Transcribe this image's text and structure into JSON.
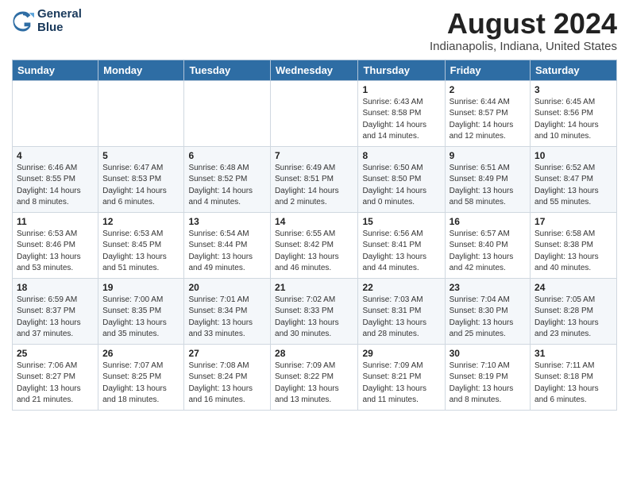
{
  "logo": {
    "line1": "General",
    "line2": "Blue"
  },
  "title": "August 2024",
  "location": "Indianapolis, Indiana, United States",
  "headers": [
    "Sunday",
    "Monday",
    "Tuesday",
    "Wednesday",
    "Thursday",
    "Friday",
    "Saturday"
  ],
  "weeks": [
    [
      {
        "day": "",
        "info": ""
      },
      {
        "day": "",
        "info": ""
      },
      {
        "day": "",
        "info": ""
      },
      {
        "day": "",
        "info": ""
      },
      {
        "day": "1",
        "info": "Sunrise: 6:43 AM\nSunset: 8:58 PM\nDaylight: 14 hours\nand 14 minutes."
      },
      {
        "day": "2",
        "info": "Sunrise: 6:44 AM\nSunset: 8:57 PM\nDaylight: 14 hours\nand 12 minutes."
      },
      {
        "day": "3",
        "info": "Sunrise: 6:45 AM\nSunset: 8:56 PM\nDaylight: 14 hours\nand 10 minutes."
      }
    ],
    [
      {
        "day": "4",
        "info": "Sunrise: 6:46 AM\nSunset: 8:55 PM\nDaylight: 14 hours\nand 8 minutes."
      },
      {
        "day": "5",
        "info": "Sunrise: 6:47 AM\nSunset: 8:53 PM\nDaylight: 14 hours\nand 6 minutes."
      },
      {
        "day": "6",
        "info": "Sunrise: 6:48 AM\nSunset: 8:52 PM\nDaylight: 14 hours\nand 4 minutes."
      },
      {
        "day": "7",
        "info": "Sunrise: 6:49 AM\nSunset: 8:51 PM\nDaylight: 14 hours\nand 2 minutes."
      },
      {
        "day": "8",
        "info": "Sunrise: 6:50 AM\nSunset: 8:50 PM\nDaylight: 14 hours\nand 0 minutes."
      },
      {
        "day": "9",
        "info": "Sunrise: 6:51 AM\nSunset: 8:49 PM\nDaylight: 13 hours\nand 58 minutes."
      },
      {
        "day": "10",
        "info": "Sunrise: 6:52 AM\nSunset: 8:47 PM\nDaylight: 13 hours\nand 55 minutes."
      }
    ],
    [
      {
        "day": "11",
        "info": "Sunrise: 6:53 AM\nSunset: 8:46 PM\nDaylight: 13 hours\nand 53 minutes."
      },
      {
        "day": "12",
        "info": "Sunrise: 6:53 AM\nSunset: 8:45 PM\nDaylight: 13 hours\nand 51 minutes."
      },
      {
        "day": "13",
        "info": "Sunrise: 6:54 AM\nSunset: 8:44 PM\nDaylight: 13 hours\nand 49 minutes."
      },
      {
        "day": "14",
        "info": "Sunrise: 6:55 AM\nSunset: 8:42 PM\nDaylight: 13 hours\nand 46 minutes."
      },
      {
        "day": "15",
        "info": "Sunrise: 6:56 AM\nSunset: 8:41 PM\nDaylight: 13 hours\nand 44 minutes."
      },
      {
        "day": "16",
        "info": "Sunrise: 6:57 AM\nSunset: 8:40 PM\nDaylight: 13 hours\nand 42 minutes."
      },
      {
        "day": "17",
        "info": "Sunrise: 6:58 AM\nSunset: 8:38 PM\nDaylight: 13 hours\nand 40 minutes."
      }
    ],
    [
      {
        "day": "18",
        "info": "Sunrise: 6:59 AM\nSunset: 8:37 PM\nDaylight: 13 hours\nand 37 minutes."
      },
      {
        "day": "19",
        "info": "Sunrise: 7:00 AM\nSunset: 8:35 PM\nDaylight: 13 hours\nand 35 minutes."
      },
      {
        "day": "20",
        "info": "Sunrise: 7:01 AM\nSunset: 8:34 PM\nDaylight: 13 hours\nand 33 minutes."
      },
      {
        "day": "21",
        "info": "Sunrise: 7:02 AM\nSunset: 8:33 PM\nDaylight: 13 hours\nand 30 minutes."
      },
      {
        "day": "22",
        "info": "Sunrise: 7:03 AM\nSunset: 8:31 PM\nDaylight: 13 hours\nand 28 minutes."
      },
      {
        "day": "23",
        "info": "Sunrise: 7:04 AM\nSunset: 8:30 PM\nDaylight: 13 hours\nand 25 minutes."
      },
      {
        "day": "24",
        "info": "Sunrise: 7:05 AM\nSunset: 8:28 PM\nDaylight: 13 hours\nand 23 minutes."
      }
    ],
    [
      {
        "day": "25",
        "info": "Sunrise: 7:06 AM\nSunset: 8:27 PM\nDaylight: 13 hours\nand 21 minutes."
      },
      {
        "day": "26",
        "info": "Sunrise: 7:07 AM\nSunset: 8:25 PM\nDaylight: 13 hours\nand 18 minutes."
      },
      {
        "day": "27",
        "info": "Sunrise: 7:08 AM\nSunset: 8:24 PM\nDaylight: 13 hours\nand 16 minutes."
      },
      {
        "day": "28",
        "info": "Sunrise: 7:09 AM\nSunset: 8:22 PM\nDaylight: 13 hours\nand 13 minutes."
      },
      {
        "day": "29",
        "info": "Sunrise: 7:09 AM\nSunset: 8:21 PM\nDaylight: 13 hours\nand 11 minutes."
      },
      {
        "day": "30",
        "info": "Sunrise: 7:10 AM\nSunset: 8:19 PM\nDaylight: 13 hours\nand 8 minutes."
      },
      {
        "day": "31",
        "info": "Sunrise: 7:11 AM\nSunset: 8:18 PM\nDaylight: 13 hours\nand 6 minutes."
      }
    ]
  ]
}
